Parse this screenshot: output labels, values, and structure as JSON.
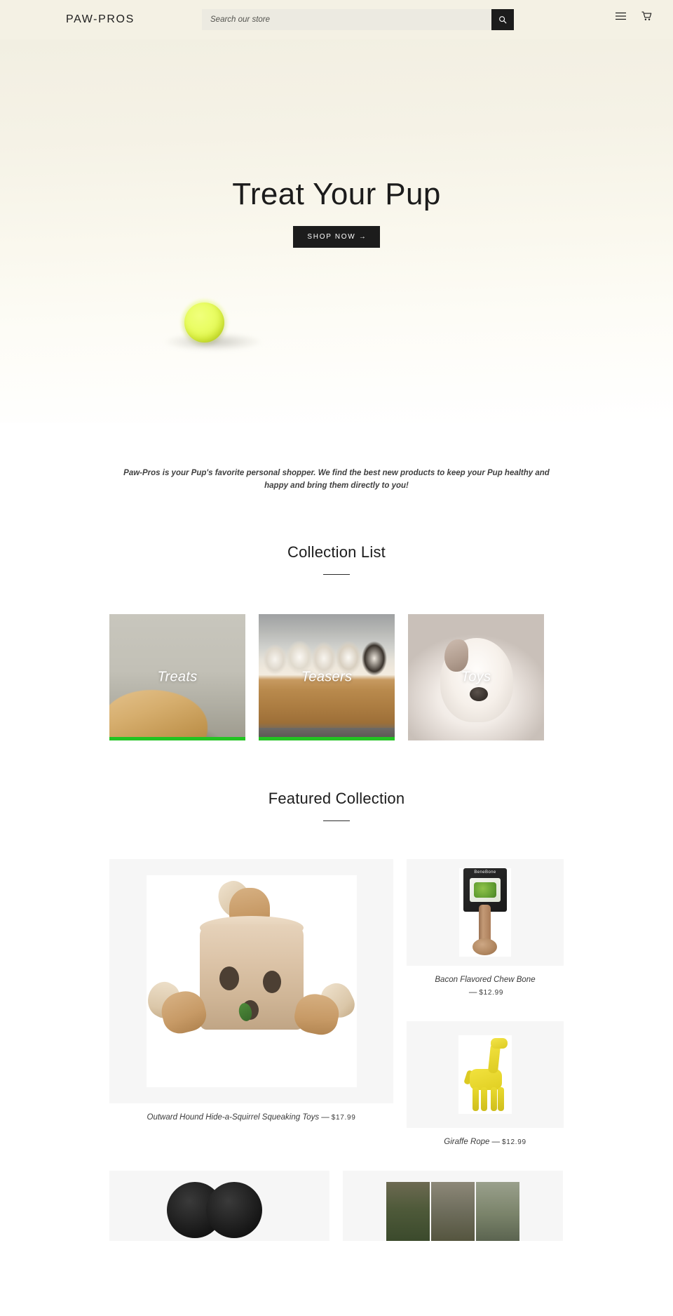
{
  "header": {
    "logo": "PAW-PROS",
    "search_placeholder": "Search our store",
    "search_value": "",
    "search_button_label": "Search",
    "menu_label": "Menu",
    "cart_label": "Cart"
  },
  "hero": {
    "title": "Treat Your Pup",
    "cta_label": "SHOP NOW →"
  },
  "intro": {
    "text": "Paw-Pros is your Pup's favorite personal shopper. We find the best new products to keep your Pup healthy and happy and bring them directly to you!"
  },
  "collection_list": {
    "title": "Collection List",
    "items": [
      {
        "label": "Treats",
        "accent": "#22c421"
      },
      {
        "label": "Teasers",
        "accent": "#22c421"
      },
      {
        "label": "Toys",
        "accent": ""
      }
    ]
  },
  "featured_collection": {
    "title": "Featured Collection",
    "products": [
      {
        "name": "Outward Hound Hide-a-Squirrel Squeaking Toys",
        "dash": "—",
        "price": "$17.99"
      },
      {
        "name": "Bacon Flavored Chew Bone",
        "dash": "—",
        "price": "$12.99",
        "brand": "BeneBone"
      },
      {
        "name": "Giraffe Rope",
        "dash": "—",
        "price": "$12.99"
      }
    ]
  },
  "colors": {
    "header_bg": "#f4f1e4",
    "button_bg": "#1c1c1c",
    "button_text": "#ffffff",
    "accent_green": "#22c421",
    "text": "#3a3a3a"
  }
}
